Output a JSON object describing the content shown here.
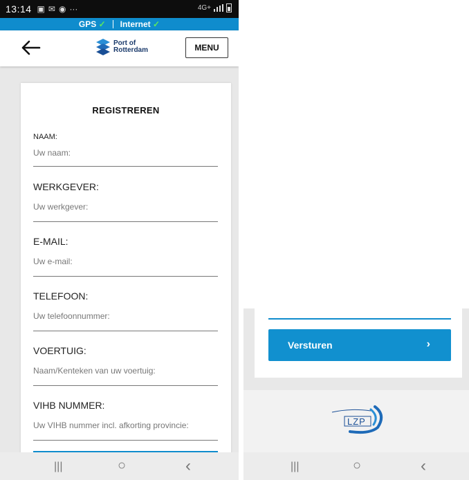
{
  "status_bar": {
    "time": "13:14",
    "dots": "···",
    "network": "4G+"
  },
  "connection": {
    "gps_label": "GPS",
    "internet_label": "Internet",
    "check": "✓"
  },
  "header": {
    "logo_line1": "Port of",
    "logo_line2": "Rotterdam",
    "menu_label": "MENU"
  },
  "form": {
    "title": "REGISTREREN",
    "fields": [
      {
        "label": "NAAM:",
        "placeholder": "Uw naam:"
      },
      {
        "label": "WERKGEVER:",
        "placeholder": "Uw werkgever:"
      },
      {
        "label": "E-MAIL:",
        "placeholder": "Uw e-mail:"
      },
      {
        "label": "TELEFOON:",
        "placeholder": "Uw telefoonnummer:"
      },
      {
        "label": "VOERTUIG:",
        "placeholder": "Naam/Kenteken van uw voertuig:"
      },
      {
        "label": "VIHB NUMMER:",
        "placeholder": "Uw VIHB nummer incl. afkorting provincie:"
      }
    ]
  },
  "submit": {
    "label": "Versturen",
    "chevron": "›"
  },
  "footer": {
    "logo_text": "LZP"
  },
  "nav": {
    "recents": "|||",
    "home": "○",
    "back": "‹"
  },
  "colors": {
    "accent": "#0f8ccd",
    "button": "#1190cf"
  }
}
